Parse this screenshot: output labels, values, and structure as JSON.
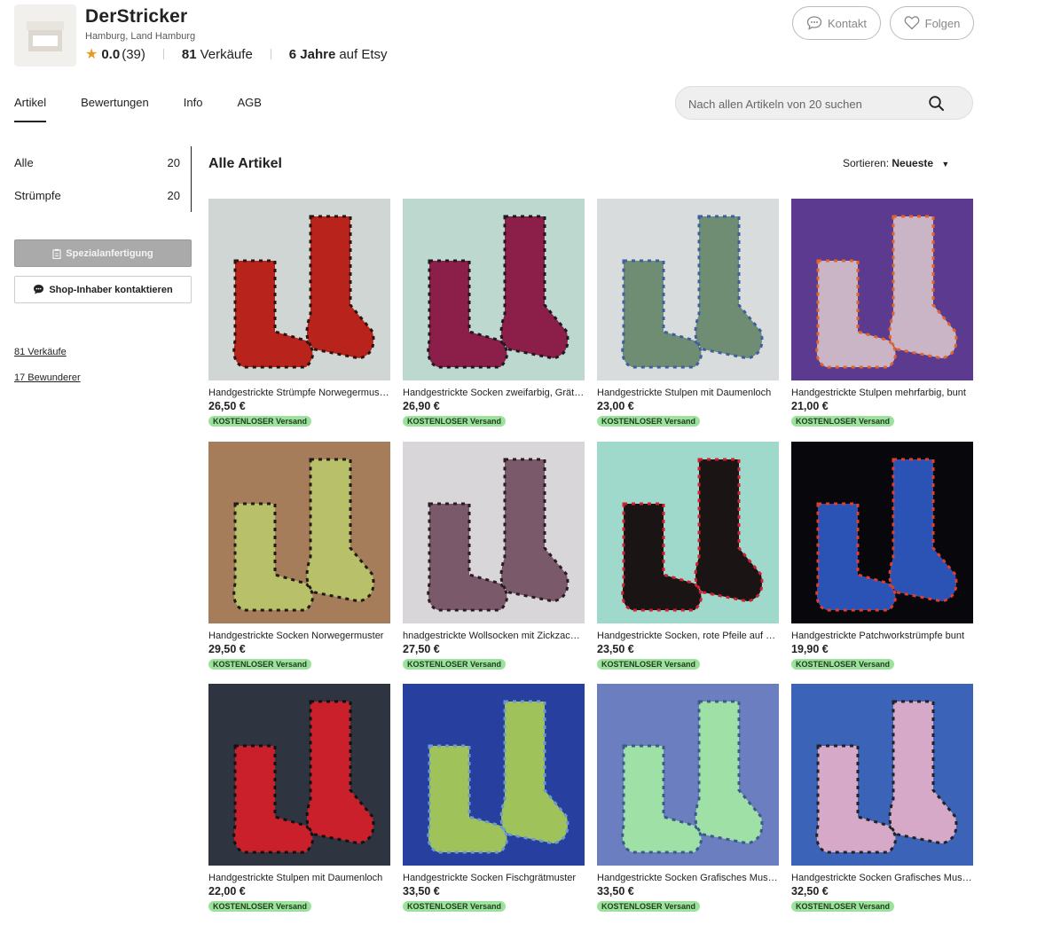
{
  "shop": {
    "name": "DerStricker",
    "location": "Hamburg, Land Hamburg",
    "rating": "0.0",
    "review_count": "(39)",
    "sales_num": "81",
    "sales_label": "Verkäufe",
    "years_num": "6 Jahre",
    "years_label": "auf Etsy",
    "contact_label": "Kontakt",
    "follow_label": "Folgen"
  },
  "tabs": [
    {
      "label": "Artikel",
      "active": true
    },
    {
      "label": "Bewertungen"
    },
    {
      "label": "Info"
    },
    {
      "label": "AGB"
    }
  ],
  "search": {
    "placeholder": "Nach allen Artikeln von 20 suchen"
  },
  "sidebar": {
    "categories": [
      {
        "label": "Alle",
        "count": "20"
      },
      {
        "label": "Strümpfe",
        "count": "20"
      }
    ],
    "custom_button": "Spezialanfertigung",
    "contact_button": "Shop-Inhaber kontaktieren",
    "sales_link": "81 Verkäufe",
    "admirers_link": "17 Bewunderer"
  },
  "main": {
    "title": "Alle Artikel",
    "sort_prefix": "Sortieren:",
    "sort_value": "Neueste"
  },
  "listings": [
    {
      "title": "Handgestrickte Strümpfe Norwegermuster",
      "price": "26,50 €",
      "badge": "KOSTENLOSER Versand",
      "bg": "#cfd6d3",
      "sock": "#b8231c",
      "accent": "#2a1410"
    },
    {
      "title": "Handgestrickte Socken zweifarbig, Grätenmuster",
      "price": "26,90 €",
      "badge": "KOSTENLOSER Versand",
      "bg": "#bcd8cf",
      "sock": "#8b1f4a",
      "accent": "#1d1a1f"
    },
    {
      "title": "Handgestrickte Stulpen mit Daumenloch",
      "price": "23,00 €",
      "badge": "KOSTENLOSER Versand",
      "bg": "#d8dcdc",
      "sock": "#6f8d72",
      "accent": "#3e5fa0"
    },
    {
      "title": "Handgestrickte Stulpen mehrfarbig, bunt",
      "price": "21,00 €",
      "badge": "KOSTENLOSER Versand",
      "bg": "#5b3a8f",
      "sock": "#c9b5c6",
      "accent": "#e2642a"
    },
    {
      "title": "Handgestrickte Socken Norwegermuster",
      "price": "29,50 €",
      "badge": "KOSTENLOSER Versand",
      "bg": "#a67d5a",
      "sock": "#b9c06a",
      "accent": "#1e1b12"
    },
    {
      "title": "hnadgestrickte Wollsocken mit Zickzackmuster",
      "price": "27,50 €",
      "badge": "KOSTENLOSER Versand",
      "bg": "#d8d6d8",
      "sock": "#7a5a6a",
      "accent": "#2b1c22"
    },
    {
      "title": "Handgestrickte Socken, rote Pfeile auf Schwarz",
      "price": "23,50 €",
      "badge": "KOSTENLOSER Versand",
      "bg": "#9fd9cc",
      "sock": "#1a1414",
      "accent": "#d51f2f"
    },
    {
      "title": "Handgestrickte Patchworkstrümpfe bunt",
      "price": "19,90 €",
      "badge": "KOSTENLOSER Versand",
      "bg": "#08080c",
      "sock": "#2a53b5",
      "accent": "#e23c2a"
    },
    {
      "title": "Handgestrickte Stulpen mit Daumenloch",
      "price": "22,00 €",
      "badge": "KOSTENLOSER Versand",
      "bg": "#2e3440",
      "sock": "#c9202c",
      "accent": "#111111"
    },
    {
      "title": "Handgestrickte Socken Fischgrätmuster",
      "price": "33,50 €",
      "badge": "KOSTENLOSER Versand",
      "bg": "#2740a0",
      "sock": "#9fc25a",
      "accent": "#6b9ad2"
    },
    {
      "title": "Handgestrickte Socken Grafisches Muster",
      "price": "33,50 €",
      "badge": "KOSTENLOSER Versand",
      "bg": "#6b7fc0",
      "sock": "#9fe0a6",
      "accent": "#3a5a8a"
    },
    {
      "title": "Handgestrickte Socken Grafisches Muster",
      "price": "32,50 €",
      "badge": "KOSTENLOSER Versand",
      "bg": "#3b63b8",
      "sock": "#d7a9c8",
      "accent": "#222222"
    }
  ]
}
